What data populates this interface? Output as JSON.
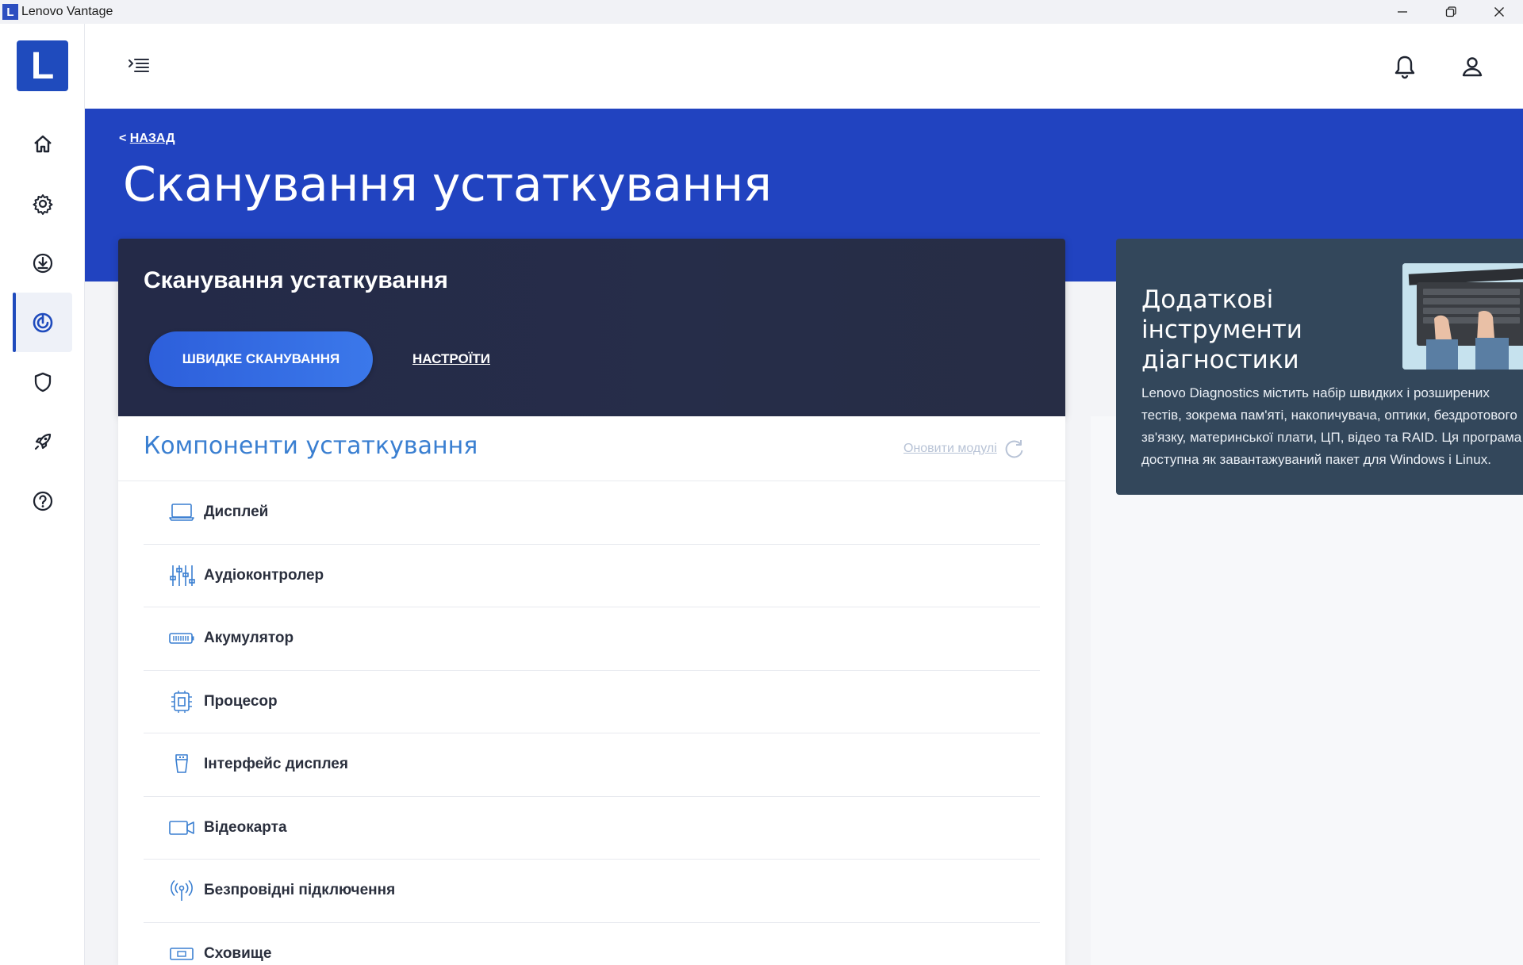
{
  "window": {
    "badge": "L",
    "title": "Lenovo Vantage"
  },
  "sidebar": {
    "logo_letter": "L",
    "items": [
      {
        "icon": "home-icon"
      },
      {
        "icon": "gear-icon"
      },
      {
        "icon": "download-icon"
      },
      {
        "icon": "hardware-scan-icon",
        "active": true
      },
      {
        "icon": "shield-icon"
      },
      {
        "icon": "rocket-icon"
      },
      {
        "icon": "help-icon"
      }
    ]
  },
  "hero": {
    "back_arrow": "<",
    "back_label": "НАЗАД",
    "title": "Сканування устаткування"
  },
  "scan_card": {
    "title": "Сканування устаткування",
    "quick_scan_label": "ШВИДКЕ СКАНУВАННЯ",
    "settings_label": "НАСТРОЇТИ"
  },
  "components": {
    "title": "Компоненти устаткування",
    "refresh_label": "Оновити модулі",
    "items": [
      {
        "label": "Дисплей",
        "icon": "laptop-icon"
      },
      {
        "label": "Аудіоконтролер",
        "icon": "audio-mixer-icon"
      },
      {
        "label": "Акумулятор",
        "icon": "battery-icon"
      },
      {
        "label": "Процесор",
        "icon": "cpu-icon"
      },
      {
        "label": "Інтерфейс дисплея",
        "icon": "display-connector-icon"
      },
      {
        "label": "Відеокарта",
        "icon": "video-camera-icon"
      },
      {
        "label": "Безпровідні підключення",
        "icon": "wireless-icon"
      },
      {
        "label": "Сховище",
        "icon": "storage-icon"
      }
    ]
  },
  "info_card": {
    "title": "Додаткові інструменти діагностики",
    "text_lines": [
      "Lenovo Diagnostics містить набір швидких і розширених",
      "тестів, зокрема пам'яті, накопичувача, оптики, бездротового",
      "зв'язку, материнської плати, ЦП, відео та RAID. Ця програма",
      "доступна як завантажуваний пакет для Windows і Linux."
    ]
  },
  "colors": {
    "brand_blue": "#2143c0",
    "accent_blue": "#3a7fd1",
    "dark_card": "#252b47",
    "info_card": "#33475b"
  }
}
